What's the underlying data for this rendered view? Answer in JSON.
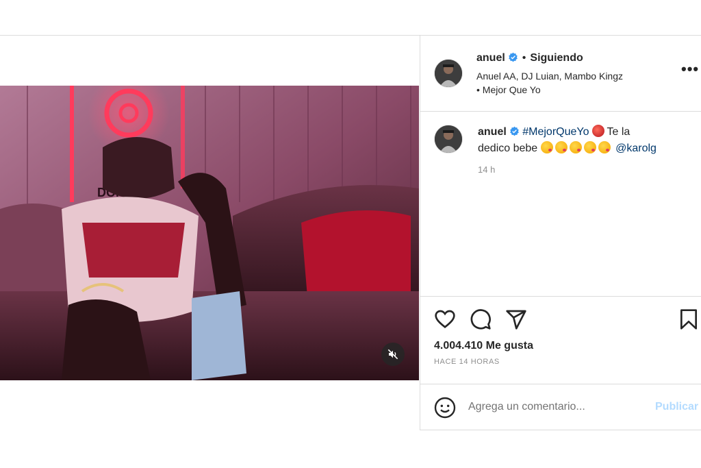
{
  "post": {
    "username": "anuel",
    "follow_state": "Siguiendo",
    "audio": "Anuel AA, DJ Luian, Mambo Kingz • Mejor Que Yo",
    "more_label": "•••"
  },
  "caption": {
    "username": "anuel",
    "hashtag": "#MejorQueYo",
    "text_part1": "Te la",
    "text_part2": "dedico bebe",
    "mention": "@karolg",
    "time": "14 h",
    "emoji": [
      "devil-face-emoji",
      "kissing-face-emoji"
    ]
  },
  "stats": {
    "likes": "4.004.410 Me gusta",
    "posted_ago": "HACE 14 HORAS"
  },
  "comment": {
    "placeholder": "Agrega un comentario...",
    "publish_label": "Publicar"
  },
  "video": {
    "sign_text": "DON",
    "muted": true
  },
  "colors": {
    "verified": "#3897f0",
    "link": "#00376b",
    "publish_disabled": "#b3dbff",
    "muted_text": "#8e8e8e",
    "divider": "#dbdbdb"
  },
  "icons": [
    "heart-icon",
    "comment-icon",
    "share-icon",
    "bookmark-icon",
    "emoji-icon",
    "muted-speaker-icon",
    "more-options-icon",
    "verified-badge-icon"
  ]
}
